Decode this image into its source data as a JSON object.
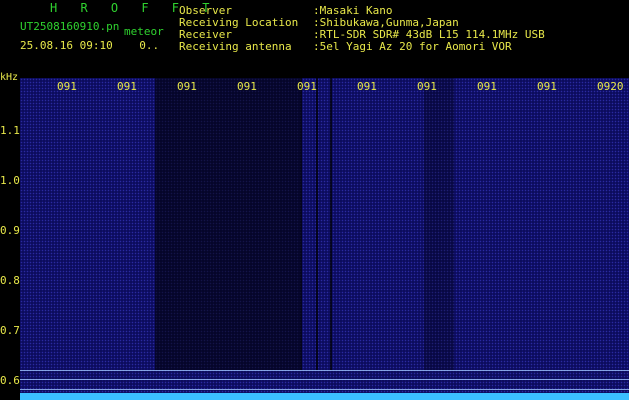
{
  "header": {
    "brand": "H R O F F T",
    "filename": "UT2508160910.pn",
    "file_type": "meteor",
    "timestamp": "25.08.16 09:10",
    "counter": "0..",
    "labels": "Observer\nReceiving Location\nReceiver\nReceiving antenna",
    "values": ":Masaki Kano\n:Shibukawa,Gunma,Japan\n:RTL-SDR SDR# 43dB L15 114.1MHz USB\n:5el Yagi Az 20 for Aomori VOR"
  },
  "axis": {
    "unit": "kHz",
    "x_ticks": [
      "091",
      "091",
      "091",
      "091",
      "091",
      "091",
      "091",
      "091",
      "091",
      "0920"
    ],
    "y_ticks": [
      "1.1",
      "1.0",
      "0.9",
      "0.8",
      "0.7",
      "0.6"
    ]
  },
  "colors": {
    "label_yellow": "#e8e84a",
    "brand_green": "#2fd22f",
    "waterfall_blue": "#0c0c5e",
    "baseline_cyan": "#3bbfff"
  }
}
